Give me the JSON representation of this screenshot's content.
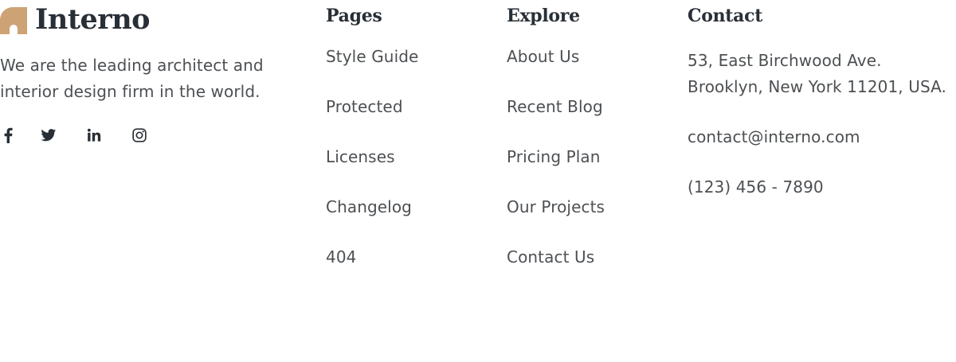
{
  "brand": {
    "name": "Interno",
    "tagline_line1": "We are the leading architect and",
    "tagline_line2": "interior design firm in the world.",
    "accent_color": "#cda274",
    "text_color": "#292f36"
  },
  "social": [
    {
      "icon": "facebook-icon",
      "name": "Facebook"
    },
    {
      "icon": "twitter-icon",
      "name": "Twitter"
    },
    {
      "icon": "linkedin-icon",
      "name": "LinkedIn"
    },
    {
      "icon": "instagram-icon",
      "name": "Instagram"
    }
  ],
  "pages": {
    "title": "Pages",
    "items": [
      "Style Guide",
      "Protected",
      "Licenses",
      "Changelog",
      "404"
    ]
  },
  "explore": {
    "title": "Explore",
    "items": [
      "About Us",
      "Recent Blog",
      "Pricing Plan",
      "Our Projects",
      "Contact Us"
    ]
  },
  "contact": {
    "title": "Contact",
    "address_line1": "53, East Birchwood Ave.",
    "address_line2": "Brooklyn, New York 11201, USA.",
    "email": "contact@interno.com",
    "phone": "(123) 456 - 7890"
  }
}
